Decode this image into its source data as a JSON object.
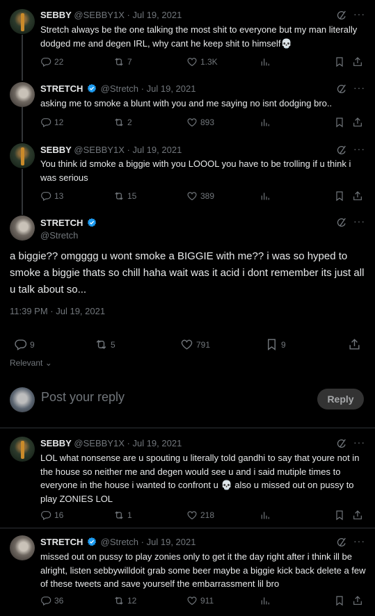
{
  "tweets": [
    {
      "name": "SEBBY",
      "handle": "@SEBBY1X",
      "dot": "·",
      "date": "Jul 19, 2021",
      "text": "Stretch always be the one talking the most shit to everyone but my man literally dodged me and degen IRL, why cant he keep shit to himself💀",
      "replies": "22",
      "reposts": "7",
      "likes": "1.3K",
      "views": ""
    },
    {
      "name": "STRETCH",
      "handle": "@Stretch",
      "dot": "·",
      "date": "Jul 19, 2021",
      "text": "asking me to smoke a blunt with you and me saying no isnt dodging bro..",
      "replies": "12",
      "reposts": "2",
      "likes": "893",
      "views": ""
    },
    {
      "name": "SEBBY",
      "handle": "@SEBBY1X",
      "dot": "·",
      "date": "Jul 19, 2021",
      "text": "You think id smoke a biggie with you LOOOL you have to be trolling if u think i was serious",
      "replies": "13",
      "reposts": "15",
      "likes": "389",
      "views": ""
    }
  ],
  "main": {
    "name": "STRETCH",
    "handle": "@Stretch",
    "text": "a biggie?? omgggg u wont smoke a BIGGIE with me?? i was so hyped to smoke a biggie thats so chill haha wait was it acid i dont remember its just all u talk about so...",
    "timestamp": "11:39 PM · Jul 19, 2021",
    "replies": "9",
    "reposts": "5",
    "likes": "791",
    "bookmarks": "9"
  },
  "sort_label": "Relevant",
  "compose": {
    "placeholder": "Post your reply",
    "button": "Reply"
  },
  "replies": [
    {
      "name": "SEBBY",
      "handle": "@SEBBY1X",
      "dot": "·",
      "date": "Jul 19, 2021",
      "text_before": "LOL what nonsense are u spouting u literally told gandhi to say that youre not in the house so neither me and degen would see u and i said mutiple times to everyone in the house i wanted to confront u",
      "emoji": "💀",
      "text_after": "also u missed out on pussy to play ZONIES LOL",
      "replies": "16",
      "reposts": "1",
      "likes": "218"
    },
    {
      "name": "STRETCH",
      "handle": "@Stretch",
      "dot": "·",
      "date": "Jul 19, 2021",
      "text": "missed out on pussy to play zonies only to get it the day right after i think ill be alright, listen sebbywilldoit grab some beer maybe a biggie kick back delete a few of these tweets and save yourself the embarrassment lil bro",
      "replies": "36",
      "reposts": "12",
      "likes": "911"
    }
  ],
  "colors": {
    "background": "#000000",
    "text": "#e7e9ea",
    "muted": "#71767b",
    "verified": "#1d9bf0",
    "divider": "#2f3336"
  }
}
